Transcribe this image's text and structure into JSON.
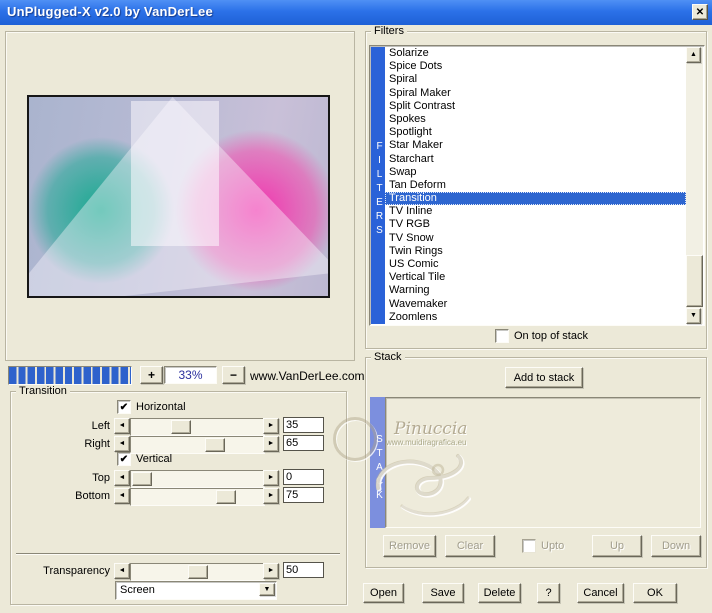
{
  "window": {
    "title": "UnPlugged-X v2.0 by VanDerLee"
  },
  "glyphs": {
    "close": "✕",
    "plus": "+",
    "minus": "−",
    "left_arrow": "◄",
    "right_arrow": "►",
    "up_arrow": "▲",
    "down_arrow": "▼",
    "check": "✔"
  },
  "preview": {
    "zoom_value": "33%",
    "website": "www.VanDerLee.com"
  },
  "filters": {
    "group_label": "Filters",
    "vertical_label": "FILTERS",
    "items": [
      "Solarize",
      "Spice Dots",
      "Spiral",
      "Spiral Maker",
      "Split Contrast",
      "Spokes",
      "Spotlight",
      "Star Maker",
      "Starchart",
      "Swap",
      "Tan Deform",
      "Transition",
      "TV Inline",
      "TV RGB",
      "TV Snow",
      "Twin Rings",
      "US Comic",
      "Vertical Tile",
      "Warning",
      "Wavemaker",
      "Zoomlens"
    ],
    "selected": "Transition",
    "on_top_label": "On top of stack",
    "on_top_checked": false
  },
  "transition": {
    "group_label": "Transition",
    "horizontal_label": "Horizontal",
    "horizontal_checked": true,
    "vertical_label": "Vertical",
    "vertical_checked": true,
    "sliders": [
      {
        "label": "Left",
        "value": "35"
      },
      {
        "label": "Right",
        "value": "65"
      },
      {
        "label": "Top",
        "value": "0"
      },
      {
        "label": "Bottom",
        "value": "75"
      },
      {
        "label": "Transparency",
        "value": "50"
      }
    ],
    "blend_mode": "Screen"
  },
  "stack": {
    "group_label": "Stack",
    "vertical_label": "STACK",
    "add_button": "Add to stack",
    "remove_button": "Remove",
    "clear_button": "Clear",
    "upto_label": "Upto",
    "upto_checked": false,
    "up_button": "Up",
    "down_button": "Down"
  },
  "footer": {
    "open": "Open",
    "save": "Save",
    "delete": "Delete",
    "help": "?",
    "cancel": "Cancel",
    "ok": "OK"
  },
  "watermark": {
    "name": "Pinuccia",
    "url": "www.muidiragrafica.eu"
  },
  "colors": {
    "dialog_bg": "#ece9d8",
    "titlebar_blue": "#2b71e8",
    "selection_blue": "#2e66d0",
    "filters_bar_blue": "#2a62d8",
    "stack_bar_blue": "#7c8fde",
    "progress_blue": "#2e62cc"
  }
}
